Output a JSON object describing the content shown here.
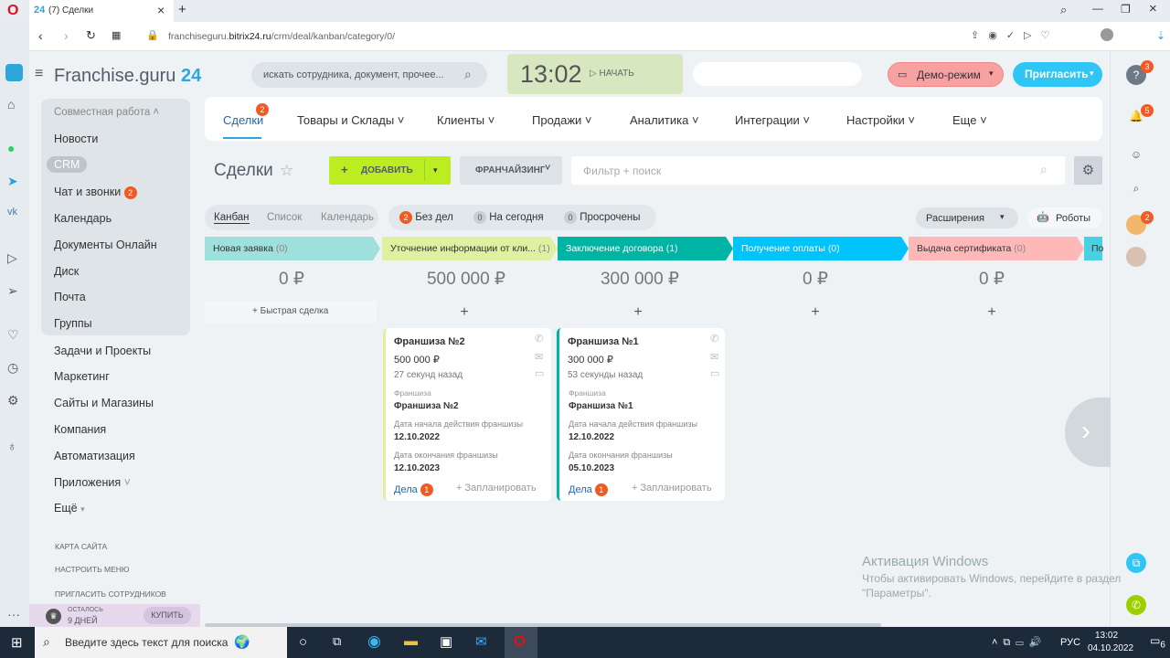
{
  "browser": {
    "tab_title": "(7) Сделки",
    "tab_logo": "24",
    "url_domain": "franchiseguru.",
    "url_host": "bitrix24.ru",
    "url_path": "/crm/deal/kanban/category/0/"
  },
  "header": {
    "logo": "Franchise.guru",
    "logo_num": "24",
    "search_placeholder": "искать сотрудника, документ, прочее...",
    "time": "13:02",
    "start_label": "НАЧАТЬ",
    "demo_label": "Демо-режим",
    "invite_label": "Пригласить",
    "help_badge": "3",
    "bell_badge": "5",
    "avatar_badge": "2"
  },
  "sidebar": {
    "group": "Совместная работа",
    "items": [
      "Новости",
      "CRM",
      "Чат и звонки",
      "Календарь",
      "Документы Онлайн",
      "Диск",
      "Почта",
      "Группы",
      "Задачи и Проекты",
      "Маркетинг",
      "Сайты и Магазины",
      "Компания",
      "Автоматизация",
      "Приложения",
      "Ещё"
    ],
    "chat_badge": "2",
    "footer": [
      "КАРТА САЙТА",
      "НАСТРОИТЬ МЕНЮ",
      "ПРИГЛАСИТЬ СОТРУДНИКОВ"
    ],
    "trial_label": "ОСТАЛОСЬ",
    "trial_days": "9 ДНЕЙ",
    "buy_label": "КУПИТЬ"
  },
  "topnav": {
    "items": [
      "Сделки",
      "Товары и Склады",
      "Клиенты",
      "Продажи",
      "Аналитика",
      "Интеграции",
      "Настройки",
      "Еще"
    ],
    "deals_badge": "2"
  },
  "toolbar": {
    "title": "Сделки",
    "add_label": "ДОБАВИТЬ",
    "category_label": "ФРАНЧАЙЗИНГ",
    "filter_placeholder": "Фильтр + поиск"
  },
  "views": {
    "items": [
      "Канбан",
      "Список",
      "Календарь"
    ],
    "counters": [
      {
        "count": "2",
        "label": "Без дел"
      },
      {
        "count": "0",
        "label": "На сегодня"
      },
      {
        "count": "0",
        "label": "Просрочены"
      }
    ],
    "extensions": "Расширения",
    "robots": "Роботы"
  },
  "stages": [
    {
      "name": "Новая заявка",
      "count": "(0)",
      "sum": "0 ₽",
      "color": "#9ee0dc"
    },
    {
      "name": "Уточнение информации от кли...",
      "count": "(1)",
      "sum": "500 000 ₽",
      "color": "#dff0a0"
    },
    {
      "name": "Заключение договора",
      "count": "(1)",
      "sum": "300 000 ₽",
      "color": "#00b4a3"
    },
    {
      "name": "Получение оплаты",
      "count": "(0)",
      "sum": "0 ₽",
      "color": "#00c4fb"
    },
    {
      "name": "Выдача сертификата",
      "count": "(0)",
      "sum": "0 ₽",
      "color": "#ffb8b8"
    },
    {
      "name": "По",
      "count": "",
      "sum": "",
      "color": "#47d1e2"
    }
  ],
  "quick_deal": "Быстрая сделка",
  "cards": [
    {
      "title": "Франшиза №2",
      "amount": "500 000 ₽",
      "time": "27 секунд назад",
      "f1_label": "Франшиза",
      "f1_value": "Франшиза №2",
      "f2_label": "Дата начала действия франшизы",
      "f2_value": "12.10.2022",
      "f3_label": "Дата окончания франшизы",
      "f3_value": "12.10.2023",
      "tasks": "Дела",
      "tasks_badge": "1",
      "plan": "+ Запланировать"
    },
    {
      "title": "Франшиза №1",
      "amount": "300 000 ₽",
      "time": "53 секунды назад",
      "f1_label": "Франшиза",
      "f1_value": "Франшиза №1",
      "f2_label": "Дата начала действия франшизы",
      "f2_value": "12.10.2022",
      "f3_label": "Дата окончания франшизы",
      "f3_value": "05.10.2023",
      "tasks": "Дела",
      "tasks_badge": "1",
      "plan": "+ Запланировать"
    }
  ],
  "watermark": {
    "title": "Активация Windows",
    "line1": "Чтобы активировать Windows, перейдите в раздел",
    "line2": "\"Параметры\"."
  },
  "taskbar": {
    "search_placeholder": "Введите здесь текст для поиска",
    "lang": "РУС",
    "time": "13:02",
    "date": "04.10.2022",
    "notif": "6"
  }
}
